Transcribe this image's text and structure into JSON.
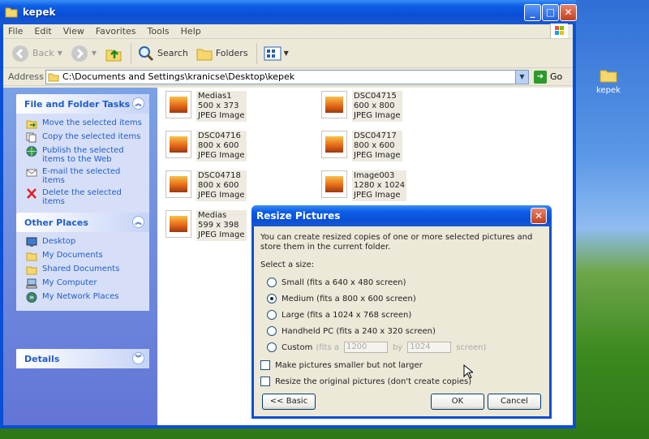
{
  "desktop": {
    "icon_label": "kepek"
  },
  "window": {
    "title": "kepek",
    "menu": [
      "File",
      "Edit",
      "View",
      "Favorites",
      "Tools",
      "Help"
    ],
    "toolbar": {
      "back": "Back",
      "search": "Search",
      "folders": "Folders"
    },
    "address_label": "Address",
    "address_value": "C:\\Documents and Settings\\kranicse\\Desktop\\kepek",
    "go_label": "Go"
  },
  "tasks_panel": {
    "title": "File and Folder Tasks",
    "items": [
      "Move the selected items",
      "Copy the selected items",
      "Publish the selected items to the Web",
      "E-mail the selected items",
      "Delete the selected items"
    ]
  },
  "places_panel": {
    "title": "Other Places",
    "items": [
      "Desktop",
      "My Documents",
      "Shared Documents",
      "My Computer",
      "My Network Places"
    ]
  },
  "details_panel": {
    "title": "Details"
  },
  "files": [
    {
      "name": "Medias1",
      "dims": "500 x 373",
      "type": "JPEG Image"
    },
    {
      "name": "DSC04715",
      "dims": "600 x 800",
      "type": "JPEG Image"
    },
    {
      "name": "DSC04716",
      "dims": "800 x 600",
      "type": "JPEG Image"
    },
    {
      "name": "DSC04717",
      "dims": "800 x 600",
      "type": "JPEG Image"
    },
    {
      "name": "DSC04718",
      "dims": "800 x 600",
      "type": "JPEG Image"
    },
    {
      "name": "Image003",
      "dims": "1280 x 1024",
      "type": "JPEG Image"
    },
    {
      "name": "Medias",
      "dims": "599 x 398",
      "type": "JPEG Image"
    }
  ],
  "dialog": {
    "title": "Resize Pictures",
    "intro": "You can create resized copies of one or more selected pictures and store them in the current folder.",
    "select_label": "Select a size:",
    "options": [
      {
        "label": "Small (fits a 640 x 480 screen)",
        "selected": false
      },
      {
        "label": "Medium (fits a 800 x 600 screen)",
        "selected": true
      },
      {
        "label": "Large (fits a 1024 x 768 screen)",
        "selected": false
      },
      {
        "label": "Handheld PC (fits a 240 x 320 screen)",
        "selected": false
      }
    ],
    "custom": {
      "label": "Custom",
      "fits_a": "(fits a",
      "width": "1200",
      "by": "by",
      "height": "1024",
      "screen": "screen)"
    },
    "checkbox_smaller": "Make pictures smaller but not larger",
    "checkbox_original": "Resize the original pictures (don't create copies)",
    "basic_button": "<< Basic",
    "ok_button": "OK",
    "cancel_button": "Cancel"
  }
}
